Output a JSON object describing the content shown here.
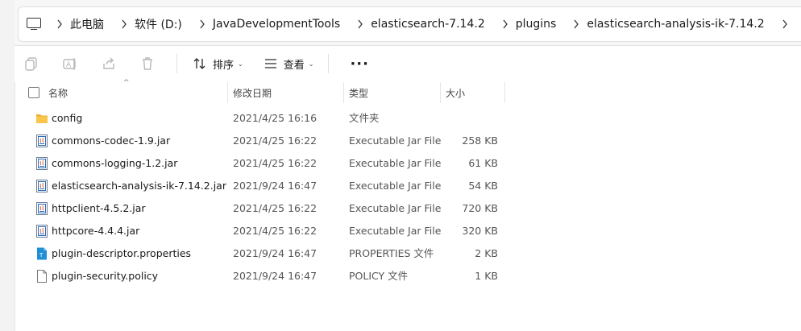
{
  "address_bar": {
    "crumbs": [
      "此电脑",
      "软件 (D:)",
      "JavaDevelopmentTools",
      "elasticsearch-7.14.2",
      "plugins",
      "elasticsearch-analysis-ik-7.14.2"
    ]
  },
  "toolbar": {
    "sort_label": "排序",
    "view_label": "查看",
    "more_label": "···"
  },
  "columns": {
    "name": "名称",
    "date": "修改日期",
    "type": "类型",
    "size": "大小"
  },
  "files": [
    {
      "name": "config",
      "date": "2021/4/25 16:16",
      "type": "文件夹",
      "size": "",
      "icon": "folder-icon"
    },
    {
      "name": "commons-codec-1.9.jar",
      "date": "2021/4/25 16:22",
      "type": "Executable Jar File",
      "size": "258 KB",
      "icon": "jar-file-icon"
    },
    {
      "name": "commons-logging-1.2.jar",
      "date": "2021/4/25 16:22",
      "type": "Executable Jar File",
      "size": "61 KB",
      "icon": "jar-file-icon"
    },
    {
      "name": "elasticsearch-analysis-ik-7.14.2.jar",
      "date": "2021/9/24 16:47",
      "type": "Executable Jar File",
      "size": "54 KB",
      "icon": "jar-file-icon"
    },
    {
      "name": "httpclient-4.5.2.jar",
      "date": "2021/4/25 16:22",
      "type": "Executable Jar File",
      "size": "720 KB",
      "icon": "jar-file-icon"
    },
    {
      "name": "httpcore-4.4.4.jar",
      "date": "2021/4/25 16:22",
      "type": "Executable Jar File",
      "size": "320 KB",
      "icon": "jar-file-icon"
    },
    {
      "name": "plugin-descriptor.properties",
      "date": "2021/9/24 16:47",
      "type": "PROPERTIES 文件",
      "size": "2 KB",
      "icon": "properties-file-icon"
    },
    {
      "name": "plugin-security.policy",
      "date": "2021/9/24 16:47",
      "type": "POLICY 文件",
      "size": "1 KB",
      "icon": "blank-file-icon"
    }
  ],
  "colors": {
    "folder": "#f8c64a",
    "jar_blue": "#2d6db5",
    "properties_blue": "#1f8fd6"
  }
}
